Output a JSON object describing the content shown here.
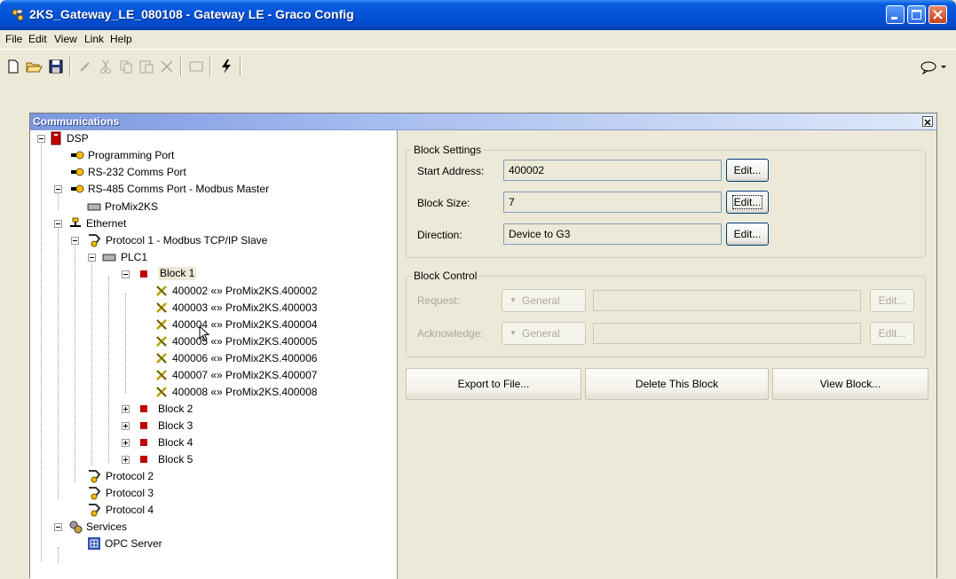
{
  "window": {
    "title": "2KS_Gateway_LE_080108 - Gateway LE - Graco Config"
  },
  "menu": [
    "File",
    "Edit",
    "View",
    "Link",
    "Help"
  ],
  "panel": {
    "title": "Communications"
  },
  "tree": {
    "dsp": "DSP",
    "programming_port": "Programming Port",
    "rs232": "RS-232 Comms Port",
    "rs485": "RS-485 Comms Port - Modbus Master",
    "promix": "ProMix2KS",
    "ethernet": "Ethernet",
    "protocol1": "Protocol 1 - Modbus TCP/IP Slave",
    "plc1": "PLC1",
    "block1": "Block 1",
    "mappings": [
      "400002 «» ProMix2KS.400002",
      "400003 «» ProMix2KS.400003",
      "400004 «» ProMix2KS.400004",
      "400005 «» ProMix2KS.400005",
      "400006 «» ProMix2KS.400006",
      "400007 «» ProMix2KS.400007",
      "400008 «» ProMix2KS.400008"
    ],
    "block2": "Block 2",
    "block3": "Block 3",
    "block4": "Block 4",
    "block5": "Block 5",
    "protocol2": "Protocol 2",
    "protocol3": "Protocol 3",
    "protocol4": "Protocol 4",
    "services": "Services",
    "opc": "OPC Server"
  },
  "block_settings": {
    "title": "Block Settings",
    "start_address_label": "Start Address:",
    "start_address_value": "400002",
    "block_size_label": "Block Size:",
    "block_size_value": "7",
    "direction_label": "Direction:",
    "direction_value": "Device to G3",
    "edit_label": "Edit..."
  },
  "block_control": {
    "title": "Block Control",
    "request_label": "Request:",
    "acknowledge_label": "Acknowledge:",
    "general_label": "General",
    "edit_label": "Edit..."
  },
  "actions": {
    "export": "Export to File...",
    "delete": "Delete This Block",
    "view": "View Block..."
  }
}
